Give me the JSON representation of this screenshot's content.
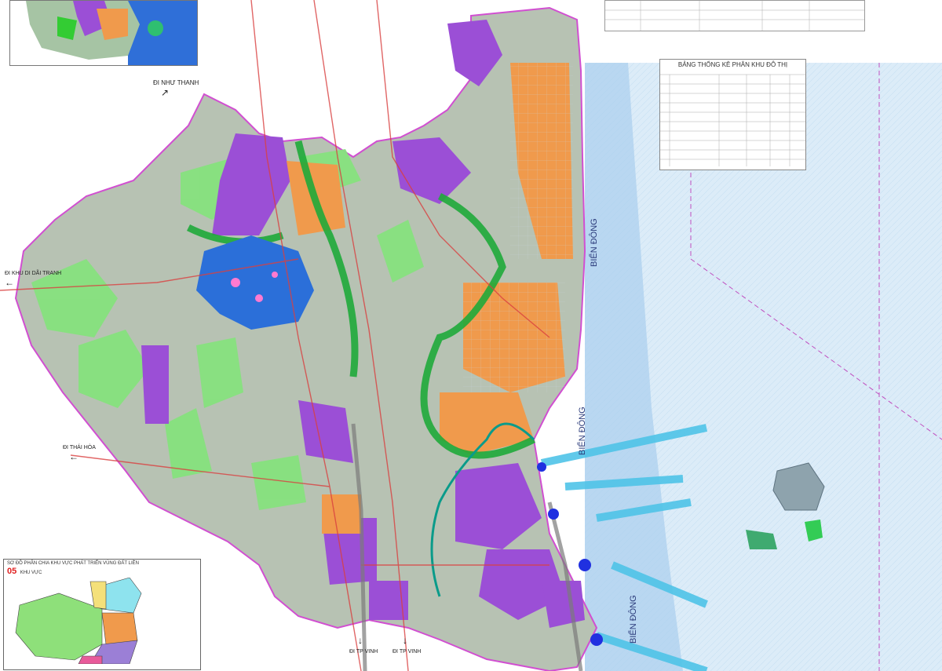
{
  "sea_labels": [
    "BIỂN ĐÔNG",
    "BIỂN ĐÔNG",
    "BIỂN ĐÔNG"
  ],
  "direction_labels": {
    "nhu_thanh": "ĐI NHƯ THANH",
    "khu_dai_tranh": "ĐI KHU DI DÃI TRANH",
    "thai_hoa": "ĐI THÁI HÒA",
    "tp_vinh_1": "ĐI TP VINH",
    "tp_vinh_2": "ĐI TP VINH"
  },
  "stats_table": {
    "title": "BẢNG THỐNG KÊ PHÂN KHU ĐÔ THỊ"
  },
  "inset_bottom": {
    "title": "SƠ ĐỒ PHÂN CHIA KHU VỰC PHÁT TRIỂN VÙNG ĐẤT LIỀN",
    "count": "05",
    "count_suffix": "KHU VỰC"
  },
  "colors": {
    "land": "#b9c3b5",
    "residential": "#f09a4c",
    "industrial": "#9b4fd6",
    "green": "#33cc33",
    "light_green": "#7fe07f",
    "water": "#2b6fd9",
    "sea": "#cfe6f7",
    "road": "#e23c3c",
    "boundary": "#d14fd1"
  },
  "icons": {
    "arrow": "arrow-icon"
  }
}
